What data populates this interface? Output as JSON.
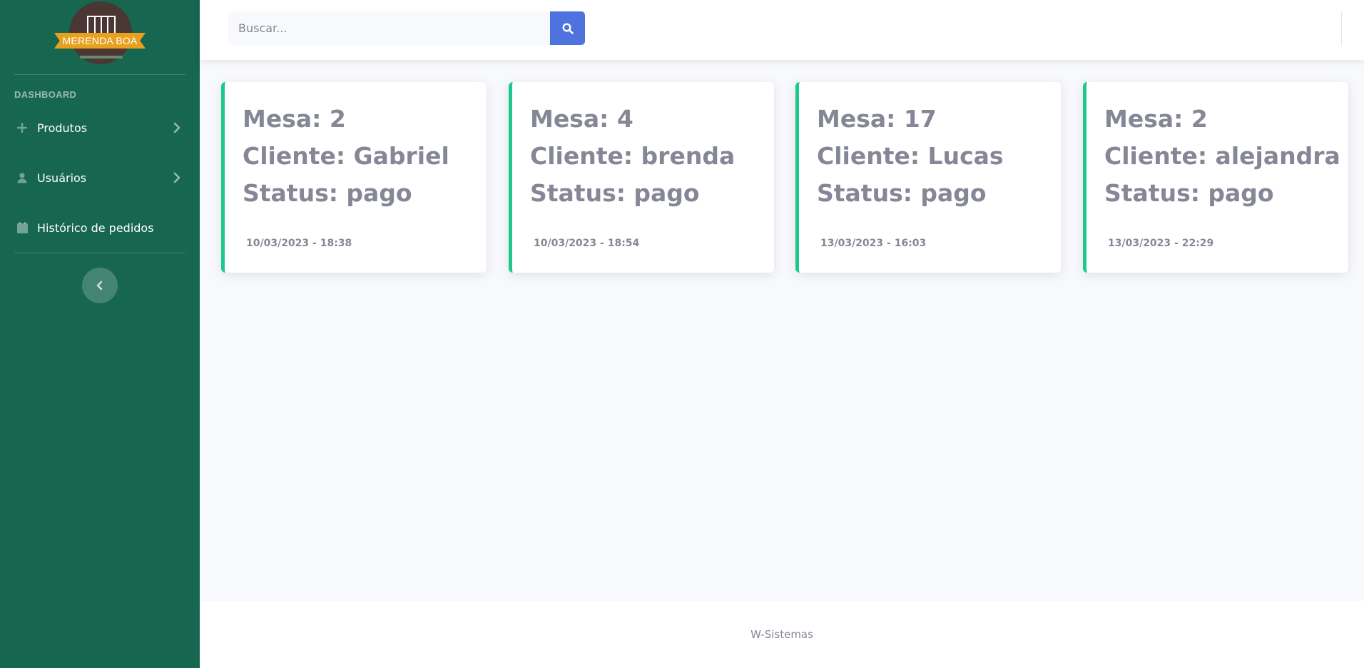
{
  "brand": {
    "name": "MERENDA BOA"
  },
  "sidebar": {
    "heading": "DASHBOARD",
    "items": [
      {
        "label": "Produtos",
        "icon": "plus-icon"
      },
      {
        "label": "Usuários",
        "icon": "user-icon"
      },
      {
        "label": "Histórico de pedidos",
        "icon": "calendar-icon"
      }
    ]
  },
  "search": {
    "placeholder": "Buscar..."
  },
  "orders": [
    {
      "mesa": "Mesa: 2",
      "cliente": "Cliente: Gabriel",
      "status": "Status: pago",
      "date": "10/03/2023 - 18:38"
    },
    {
      "mesa": "Mesa: 4",
      "cliente": "Cliente: brenda",
      "status": "Status: pago",
      "date": "10/03/2023 - 18:54"
    },
    {
      "mesa": "Mesa: 17",
      "cliente": "Cliente: Lucas",
      "status": "Status: pago",
      "date": "13/03/2023 - 16:03"
    },
    {
      "mesa": "Mesa: 2",
      "cliente": "Cliente: alejandra",
      "status": "Status: pago",
      "date": "13/03/2023 - 22:29"
    }
  ],
  "footer": {
    "text": "W-Sistemas"
  },
  "colors": {
    "sidebar": "#176650",
    "accent": "#4e73df",
    "card_border": "#1cc88a",
    "text_muted": "#858796"
  }
}
